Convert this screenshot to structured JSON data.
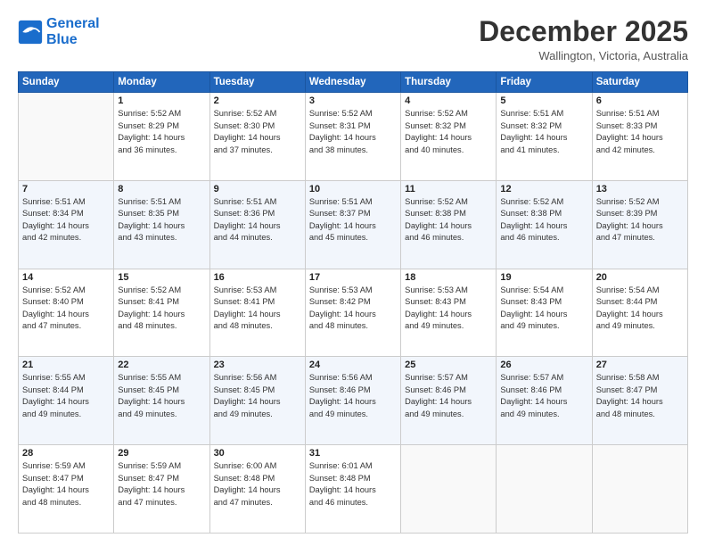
{
  "logo": {
    "line1": "General",
    "line2": "Blue"
  },
  "header": {
    "month": "December 2025",
    "location": "Wallington, Victoria, Australia"
  },
  "days_of_week": [
    "Sunday",
    "Monday",
    "Tuesday",
    "Wednesday",
    "Thursday",
    "Friday",
    "Saturday"
  ],
  "weeks": [
    [
      {
        "day": "",
        "lines": []
      },
      {
        "day": "1",
        "lines": [
          "Sunrise: 5:52 AM",
          "Sunset: 8:29 PM",
          "Daylight: 14 hours",
          "and 36 minutes."
        ]
      },
      {
        "day": "2",
        "lines": [
          "Sunrise: 5:52 AM",
          "Sunset: 8:30 PM",
          "Daylight: 14 hours",
          "and 37 minutes."
        ]
      },
      {
        "day": "3",
        "lines": [
          "Sunrise: 5:52 AM",
          "Sunset: 8:31 PM",
          "Daylight: 14 hours",
          "and 38 minutes."
        ]
      },
      {
        "day": "4",
        "lines": [
          "Sunrise: 5:52 AM",
          "Sunset: 8:32 PM",
          "Daylight: 14 hours",
          "and 40 minutes."
        ]
      },
      {
        "day": "5",
        "lines": [
          "Sunrise: 5:51 AM",
          "Sunset: 8:32 PM",
          "Daylight: 14 hours",
          "and 41 minutes."
        ]
      },
      {
        "day": "6",
        "lines": [
          "Sunrise: 5:51 AM",
          "Sunset: 8:33 PM",
          "Daylight: 14 hours",
          "and 42 minutes."
        ]
      }
    ],
    [
      {
        "day": "7",
        "lines": [
          "Sunrise: 5:51 AM",
          "Sunset: 8:34 PM",
          "Daylight: 14 hours",
          "and 42 minutes."
        ]
      },
      {
        "day": "8",
        "lines": [
          "Sunrise: 5:51 AM",
          "Sunset: 8:35 PM",
          "Daylight: 14 hours",
          "and 43 minutes."
        ]
      },
      {
        "day": "9",
        "lines": [
          "Sunrise: 5:51 AM",
          "Sunset: 8:36 PM",
          "Daylight: 14 hours",
          "and 44 minutes."
        ]
      },
      {
        "day": "10",
        "lines": [
          "Sunrise: 5:51 AM",
          "Sunset: 8:37 PM",
          "Daylight: 14 hours",
          "and 45 minutes."
        ]
      },
      {
        "day": "11",
        "lines": [
          "Sunrise: 5:52 AM",
          "Sunset: 8:38 PM",
          "Daylight: 14 hours",
          "and 46 minutes."
        ]
      },
      {
        "day": "12",
        "lines": [
          "Sunrise: 5:52 AM",
          "Sunset: 8:38 PM",
          "Daylight: 14 hours",
          "and 46 minutes."
        ]
      },
      {
        "day": "13",
        "lines": [
          "Sunrise: 5:52 AM",
          "Sunset: 8:39 PM",
          "Daylight: 14 hours",
          "and 47 minutes."
        ]
      }
    ],
    [
      {
        "day": "14",
        "lines": [
          "Sunrise: 5:52 AM",
          "Sunset: 8:40 PM",
          "Daylight: 14 hours",
          "and 47 minutes."
        ]
      },
      {
        "day": "15",
        "lines": [
          "Sunrise: 5:52 AM",
          "Sunset: 8:41 PM",
          "Daylight: 14 hours",
          "and 48 minutes."
        ]
      },
      {
        "day": "16",
        "lines": [
          "Sunrise: 5:53 AM",
          "Sunset: 8:41 PM",
          "Daylight: 14 hours",
          "and 48 minutes."
        ]
      },
      {
        "day": "17",
        "lines": [
          "Sunrise: 5:53 AM",
          "Sunset: 8:42 PM",
          "Daylight: 14 hours",
          "and 48 minutes."
        ]
      },
      {
        "day": "18",
        "lines": [
          "Sunrise: 5:53 AM",
          "Sunset: 8:43 PM",
          "Daylight: 14 hours",
          "and 49 minutes."
        ]
      },
      {
        "day": "19",
        "lines": [
          "Sunrise: 5:54 AM",
          "Sunset: 8:43 PM",
          "Daylight: 14 hours",
          "and 49 minutes."
        ]
      },
      {
        "day": "20",
        "lines": [
          "Sunrise: 5:54 AM",
          "Sunset: 8:44 PM",
          "Daylight: 14 hours",
          "and 49 minutes."
        ]
      }
    ],
    [
      {
        "day": "21",
        "lines": [
          "Sunrise: 5:55 AM",
          "Sunset: 8:44 PM",
          "Daylight: 14 hours",
          "and 49 minutes."
        ]
      },
      {
        "day": "22",
        "lines": [
          "Sunrise: 5:55 AM",
          "Sunset: 8:45 PM",
          "Daylight: 14 hours",
          "and 49 minutes."
        ]
      },
      {
        "day": "23",
        "lines": [
          "Sunrise: 5:56 AM",
          "Sunset: 8:45 PM",
          "Daylight: 14 hours",
          "and 49 minutes."
        ]
      },
      {
        "day": "24",
        "lines": [
          "Sunrise: 5:56 AM",
          "Sunset: 8:46 PM",
          "Daylight: 14 hours",
          "and 49 minutes."
        ]
      },
      {
        "day": "25",
        "lines": [
          "Sunrise: 5:57 AM",
          "Sunset: 8:46 PM",
          "Daylight: 14 hours",
          "and 49 minutes."
        ]
      },
      {
        "day": "26",
        "lines": [
          "Sunrise: 5:57 AM",
          "Sunset: 8:46 PM",
          "Daylight: 14 hours",
          "and 49 minutes."
        ]
      },
      {
        "day": "27",
        "lines": [
          "Sunrise: 5:58 AM",
          "Sunset: 8:47 PM",
          "Daylight: 14 hours",
          "and 48 minutes."
        ]
      }
    ],
    [
      {
        "day": "28",
        "lines": [
          "Sunrise: 5:59 AM",
          "Sunset: 8:47 PM",
          "Daylight: 14 hours",
          "and 48 minutes."
        ]
      },
      {
        "day": "29",
        "lines": [
          "Sunrise: 5:59 AM",
          "Sunset: 8:47 PM",
          "Daylight: 14 hours",
          "and 47 minutes."
        ]
      },
      {
        "day": "30",
        "lines": [
          "Sunrise: 6:00 AM",
          "Sunset: 8:48 PM",
          "Daylight: 14 hours",
          "and 47 minutes."
        ]
      },
      {
        "day": "31",
        "lines": [
          "Sunrise: 6:01 AM",
          "Sunset: 8:48 PM",
          "Daylight: 14 hours",
          "and 46 minutes."
        ]
      },
      {
        "day": "",
        "lines": []
      },
      {
        "day": "",
        "lines": []
      },
      {
        "day": "",
        "lines": []
      }
    ]
  ]
}
